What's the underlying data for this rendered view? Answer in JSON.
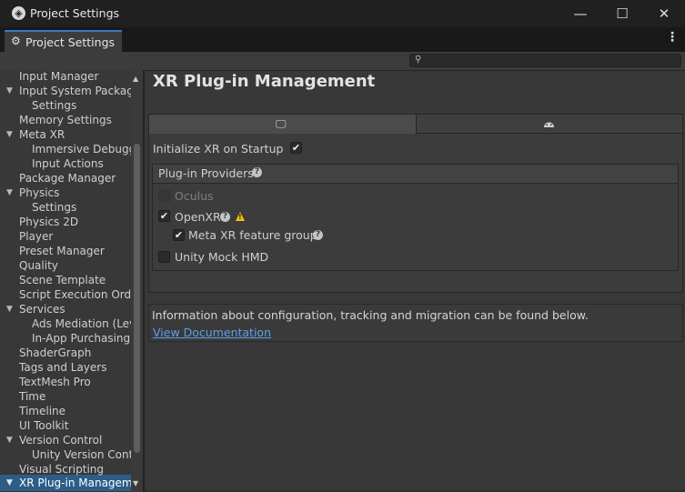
{
  "window": {
    "title": "Project Settings",
    "minimize": "—",
    "maximize": "☐",
    "close": "✕"
  },
  "tab": {
    "label": "Project Settings",
    "more": "⋮"
  },
  "search": {
    "placeholder": ""
  },
  "sidebar": {
    "items": [
      {
        "label": "Input Manager"
      },
      {
        "label": "Input System Package"
      },
      {
        "label": "Settings"
      },
      {
        "label": "Memory Settings"
      },
      {
        "label": "Meta XR"
      },
      {
        "label": "Immersive Debugger"
      },
      {
        "label": "Input Actions"
      },
      {
        "label": "Package Manager"
      },
      {
        "label": "Physics"
      },
      {
        "label": "Settings"
      },
      {
        "label": "Physics 2D"
      },
      {
        "label": "Player"
      },
      {
        "label": "Preset Manager"
      },
      {
        "label": "Quality"
      },
      {
        "label": "Scene Template"
      },
      {
        "label": "Script Execution Order"
      },
      {
        "label": "Services"
      },
      {
        "label": "Ads Mediation (Levels)"
      },
      {
        "label": "In-App Purchasing"
      },
      {
        "label": "ShaderGraph"
      },
      {
        "label": "Tags and Layers"
      },
      {
        "label": "TextMesh Pro"
      },
      {
        "label": "Time"
      },
      {
        "label": "Timeline"
      },
      {
        "label": "UI Toolkit"
      },
      {
        "label": "Version Control"
      },
      {
        "label": "Unity Version Control"
      },
      {
        "label": "Visual Scripting"
      },
      {
        "label": "XR Plug-in Management"
      }
    ]
  },
  "main": {
    "title": "XR Plug-in Management",
    "initialize_label": "Initialize XR on Startup",
    "initialize_checked": true,
    "providers_header": "Plug-in Providers",
    "providers": [
      {
        "label": "Oculus",
        "checked": false,
        "enabled": false
      },
      {
        "label": "OpenXR",
        "checked": true,
        "enabled": true,
        "warning": true
      },
      {
        "label": "Meta XR feature group",
        "checked": true,
        "enabled": true
      },
      {
        "label": "Unity Mock HMD",
        "checked": false,
        "enabled": true
      }
    ],
    "info_text": "Information about configuration, tracking and migration can be found below.",
    "doc_link": "View Documentation"
  },
  "icons": {
    "app": "unity-icon",
    "gear": "gear-icon",
    "search": "search-icon",
    "desktop": "desktop-icon",
    "android": "android-icon",
    "help": "help-icon",
    "warning": "warning-icon"
  },
  "colors": {
    "accent": "#3a79bb",
    "selection": "#2c5d87",
    "link": "#5d9ee8",
    "warning": "#f4c20d"
  }
}
